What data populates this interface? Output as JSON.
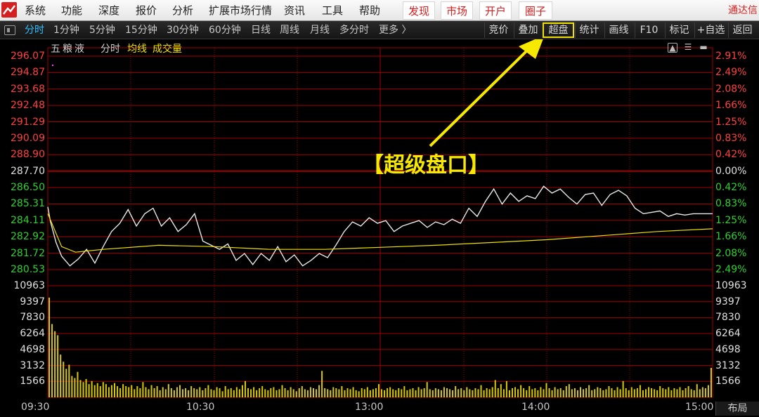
{
  "menu": {
    "items": [
      "系统",
      "功能",
      "深度",
      "报价",
      "分析",
      "扩展市场行情",
      "资讯",
      "工具",
      "帮助"
    ],
    "highlight": [
      "发现",
      "市场",
      "开户",
      "圈子"
    ],
    "brand": "通达信"
  },
  "periods": {
    "items": [
      "分时",
      "1分钟",
      "5分钟",
      "15分钟",
      "30分钟",
      "60分钟",
      "日线",
      "周线",
      "月线",
      "多分时",
      "更多 〉"
    ],
    "active": "分时"
  },
  "tools": [
    "竞价",
    "叠加",
    "超盘",
    "统计",
    "画线",
    "F10",
    "标记",
    "+自选",
    "返回"
  ],
  "chart": {
    "stock_name": "五粮液",
    "legend": {
      "time": "分时",
      "avg": "均线",
      "vol": "成交量"
    },
    "price_labels": [
      "296.07",
      "294.87",
      "293.68",
      "292.48",
      "291.29",
      "290.09",
      "288.90",
      "287.70",
      "286.50",
      "285.31",
      "284.11",
      "282.92",
      "281.72",
      "280.53"
    ],
    "pct_labels": [
      "2.91%",
      "2.49%",
      "2.08%",
      "1.66%",
      "1.25%",
      "0.83%",
      "0.42%",
      "0.00%",
      "0.42%",
      "0.83%",
      "1.25%",
      "1.66%",
      "2.08%",
      "2.49%"
    ],
    "volume_labels": [
      "10963",
      "9397",
      "7830",
      "6264",
      "4698",
      "3132",
      "1566"
    ],
    "time_labels": [
      "09:30",
      "10:30",
      "13:00",
      "14:00",
      "15:00"
    ],
    "layout_button": "布局",
    "annotation": "【超级盘口】"
  },
  "chart_data": {
    "type": "line",
    "x_range": [
      "09:30",
      "15:00"
    ],
    "ylim": [
      280.53,
      296.07
    ],
    "prev_close": 287.7,
    "series": [
      {
        "name": "分时",
        "color": "#e8e8e8",
        "x": [
          0,
          1,
          3,
          5,
          8,
          11,
          14,
          17,
          20,
          23,
          26,
          29,
          32,
          35,
          38,
          41,
          44,
          47,
          50,
          53,
          56,
          59,
          62,
          65,
          68,
          71,
          74,
          77,
          80,
          83,
          86,
          89,
          92,
          95,
          98,
          101,
          104,
          107,
          110,
          113,
          116,
          119,
          122,
          125,
          128,
          131,
          134,
          137,
          140,
          143,
          146,
          149,
          152,
          155,
          158,
          161,
          164,
          167,
          170,
          173,
          176,
          179,
          182,
          185,
          188,
          191,
          194,
          197,
          200,
          203,
          206,
          209,
          212,
          215,
          218,
          221,
          224,
          227,
          230,
          233,
          236,
          239,
          240
        ],
        "values": [
          285.1,
          284.0,
          282.5,
          281.5,
          280.8,
          281.3,
          282.0,
          281.0,
          282.2,
          283.3,
          283.9,
          284.9,
          283.7,
          284.6,
          285.0,
          283.7,
          284.3,
          283.3,
          283.8,
          284.6,
          282.6,
          282.3,
          282.0,
          282.4,
          281.2,
          281.7,
          280.9,
          281.7,
          281.2,
          282.2,
          281.1,
          281.6,
          280.8,
          281.2,
          281.7,
          281.4,
          282.3,
          283.3,
          284.0,
          283.7,
          284.3,
          283.9,
          284.1,
          283.3,
          283.7,
          283.9,
          284.1,
          283.6,
          284.0,
          283.8,
          284.2,
          283.9,
          285.0,
          284.4,
          285.5,
          286.4,
          285.3,
          286.1,
          285.5,
          285.9,
          285.7,
          286.6,
          286.1,
          286.4,
          285.8,
          285.3,
          286.0,
          286.1,
          285.2,
          286.0,
          286.3,
          285.9,
          285.0,
          284.6,
          284.7,
          284.8,
          284.4,
          284.6,
          284.5,
          284.6,
          284.6,
          284.6,
          284.6
        ]
      },
      {
        "name": "均线",
        "color": "#f0e000",
        "x": [
          0,
          5,
          10,
          20,
          40,
          60,
          80,
          100,
          120,
          140,
          160,
          180,
          200,
          220,
          240
        ],
        "values": [
          284.6,
          282.2,
          281.8,
          282.0,
          282.3,
          282.2,
          282.0,
          282.0,
          282.15,
          282.3,
          282.5,
          282.7,
          283.0,
          283.3,
          283.5
        ]
      }
    ],
    "volume": {
      "name": "成交量",
      "ylim": [
        0,
        10963
      ],
      "values": [
        9800,
        7200,
        6500,
        6100,
        4200,
        3500,
        2800,
        3200,
        2100,
        1900,
        2500,
        1700,
        1500,
        1800,
        1300,
        1600,
        1200,
        1400,
        1100,
        1500,
        1300,
        1000,
        1200,
        1400,
        1100,
        900,
        1300,
        1100,
        1000,
        1200,
        800,
        1100,
        900,
        1500,
        1000,
        800,
        1200,
        900,
        1100,
        700,
        1000,
        800,
        1300,
        900,
        700,
        1000,
        1200,
        800,
        900,
        700,
        1100,
        900,
        800,
        1000,
        700,
        900,
        1200,
        800,
        700,
        1000,
        900,
        600,
        1100,
        800,
        900,
        700,
        1000,
        800,
        1200,
        1600,
        900,
        800,
        1000,
        700,
        900,
        1100,
        800,
        700,
        900,
        1000,
        700,
        800,
        1200,
        900,
        700,
        1000,
        800,
        600,
        900,
        1100,
        800,
        700,
        1000,
        900,
        800,
        1200,
        2600,
        900,
        800,
        700,
        1000,
        900,
        800,
        1100,
        700,
        900,
        800,
        1000,
        700,
        600,
        900,
        800,
        1000,
        700,
        800,
        900,
        1300,
        800,
        700,
        900,
        1000,
        800,
        700,
        900,
        800,
        1100,
        700,
        800,
        900,
        700,
        1000,
        800,
        900,
        1500,
        800,
        700,
        900,
        800,
        700,
        1000,
        900,
        800,
        700,
        1100,
        800,
        900,
        700,
        1000,
        800,
        700,
        900,
        800,
        1200,
        700,
        900,
        800,
        1000,
        1700,
        900,
        1300,
        800,
        1600,
        700,
        900,
        1000,
        800,
        1200,
        900,
        700,
        1100,
        800,
        900,
        700,
        1000,
        800,
        1400,
        900,
        700,
        1000,
        800,
        900,
        700,
        1100,
        1300,
        800,
        900,
        700,
        1000,
        800,
        900,
        1200,
        700,
        800,
        1000,
        900,
        700,
        800,
        1100,
        900,
        700,
        1000,
        800,
        1600,
        900,
        700,
        1000,
        800,
        900,
        1200,
        700,
        800,
        1000,
        900,
        800,
        700,
        1100,
        900,
        800,
        1000,
        700,
        900,
        800,
        1000,
        700,
        900,
        1100,
        800,
        700,
        1300,
        800,
        1000,
        900,
        1200,
        2900
      ]
    }
  },
  "colors": {
    "up": "#ff4040",
    "down": "#30d030",
    "neutral": "#e0e0e0",
    "grid": "#a00000",
    "highlight": "#f7e800"
  }
}
